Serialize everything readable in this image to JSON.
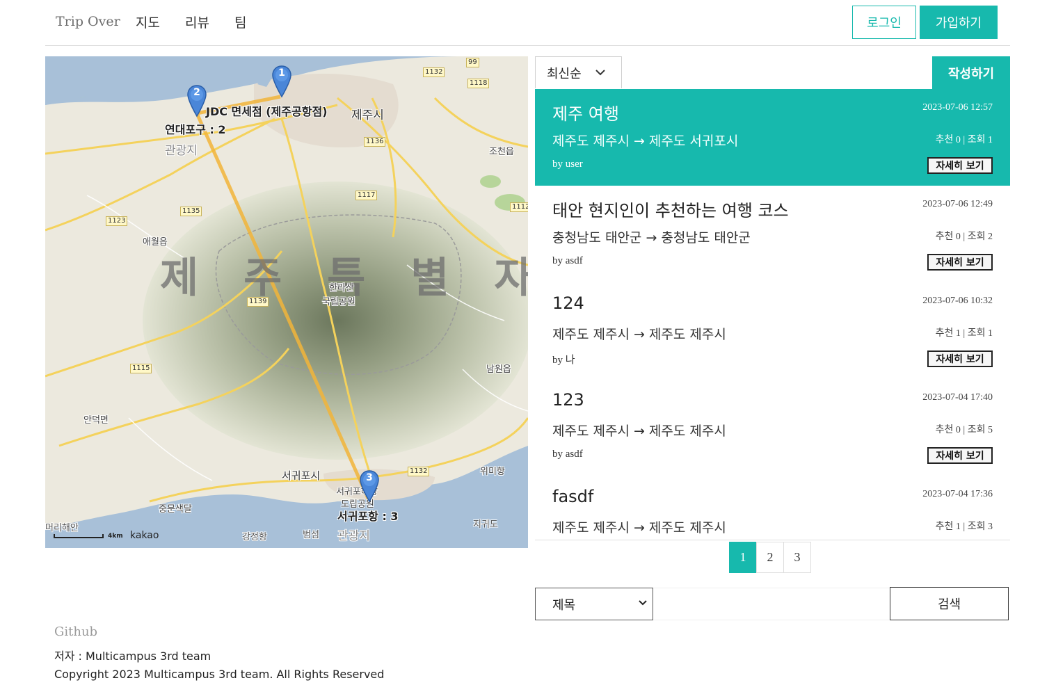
{
  "nav": {
    "brand": "Trip Over",
    "links": [
      "지도",
      "리뷰",
      "팀"
    ],
    "login_label": "로그인",
    "signup_label": "가입하기"
  },
  "map": {
    "region_label": "제 주 특 별 자 치",
    "attribution": "kakao",
    "scale_label": "4km",
    "place_labels": {
      "jeju_city": "제주시",
      "aewol": "애월읍",
      "hallasan": "한라산",
      "national_park": "국립공원",
      "andeok": "안덕면",
      "namwon": "남원읍",
      "seogwipo": "서귀포시",
      "jungmun": "중문색달",
      "wimi": "위미항",
      "jocheon": "조천읍",
      "gwangwangji_top": "관광지",
      "gwangwangji_bottom": "관광지",
      "beomseom": "범섬",
      "gangjeong": "강정항",
      "jigwido": "지귀도",
      "coast": "머리해안",
      "marine_park": "서귀포해양",
      "marine_park_2": "도립공원"
    },
    "road_numbers": [
      "99",
      "1132",
      "1118",
      "1136",
      "1117",
      "1135",
      "1123",
      "1112",
      "1139",
      "1115",
      "1132"
    ],
    "markers": [
      {
        "number": "1",
        "label": "JDC 면세점 (제주공항점)"
      },
      {
        "number": "2",
        "label": "연대포구 : 2"
      },
      {
        "number": "3",
        "label": "서귀포항 : 3"
      }
    ]
  },
  "list": {
    "sort_label": "최신순",
    "write_label": "작성하기",
    "detail_label": "자세히 보기",
    "items": [
      {
        "title": "제주 여행",
        "date": "2023-07-06 12:57",
        "route": "제주도 제주시 → 제주도 서귀포시",
        "stats": "추천 0 | 조회 1",
        "author": "by user"
      },
      {
        "title": "태안 현지인이 추천하는 여행 코스",
        "date": "2023-07-06 12:49",
        "route": "충청남도 태안군 → 충청남도 태안군",
        "stats": "추천 0 | 조회 2",
        "author": "by asdf"
      },
      {
        "title": "124",
        "date": "2023-07-06 10:32",
        "route": "제주도 제주시 → 제주도 제주시",
        "stats": "추천 1 | 조회 1",
        "author": "by 나"
      },
      {
        "title": "123",
        "date": "2023-07-04 17:40",
        "route": "제주도 제주시 → 제주도 제주시",
        "stats": "추천 0 | 조회 5",
        "author": "by asdf"
      },
      {
        "title": "fasdf",
        "date": "2023-07-04 17:36",
        "route": "제주도 제주시 → 제주도 제주시",
        "stats": "추천 1 | 조회 3",
        "author": ""
      }
    ]
  },
  "pagination": {
    "pages": [
      "1",
      "2",
      "3"
    ],
    "current": "1"
  },
  "search": {
    "field_selected": "제목",
    "query_value": "",
    "button_label": "검색"
  },
  "footer": {
    "github": "Github",
    "author": "저자 : Multicampus 3rd team",
    "copyright": "Copyright 2023 Multicampus 3rd team. All Rights Reserved"
  },
  "colors": {
    "accent": "#17b9ad",
    "route_line": "#f2b53a",
    "marker": "#4a86d8"
  }
}
